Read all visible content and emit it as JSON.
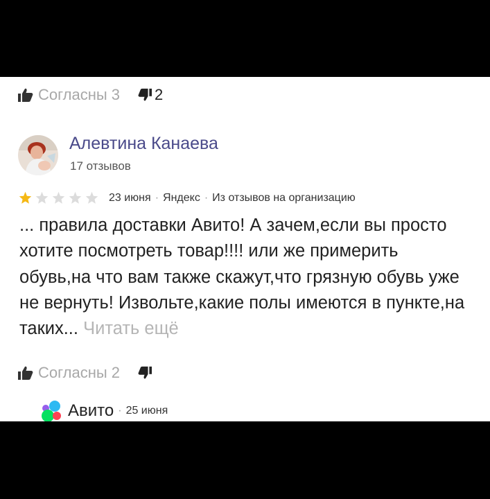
{
  "top_votes": {
    "agree_label": "Согласны 3",
    "dislike_count": "2"
  },
  "author": {
    "name": "Алевтина Канаева",
    "reviews": "17 отзывов"
  },
  "rating": {
    "stars": 1,
    "max": 5
  },
  "meta": {
    "date": "23 июня",
    "source": "Яндекс",
    "origin": "Из отзывов на организацию"
  },
  "review": {
    "text": "... правила доставки Авито! А зачем,если вы просто хотите посмотреть товар!!!! или же примерить обувь,на что вам также скажут,что грязную обувь уже не вернуть! Извольте,какие полы имеются в пункте,на таких...",
    "read_more": "Читать ещё"
  },
  "bottom_votes": {
    "agree_label": "Согласны 2"
  },
  "reply": {
    "name": "Авито",
    "date": "25 июня"
  },
  "colors": {
    "star_active": "#f5b815",
    "star_inactive": "#dcdcdc",
    "read_more": "#b5b5b5"
  }
}
